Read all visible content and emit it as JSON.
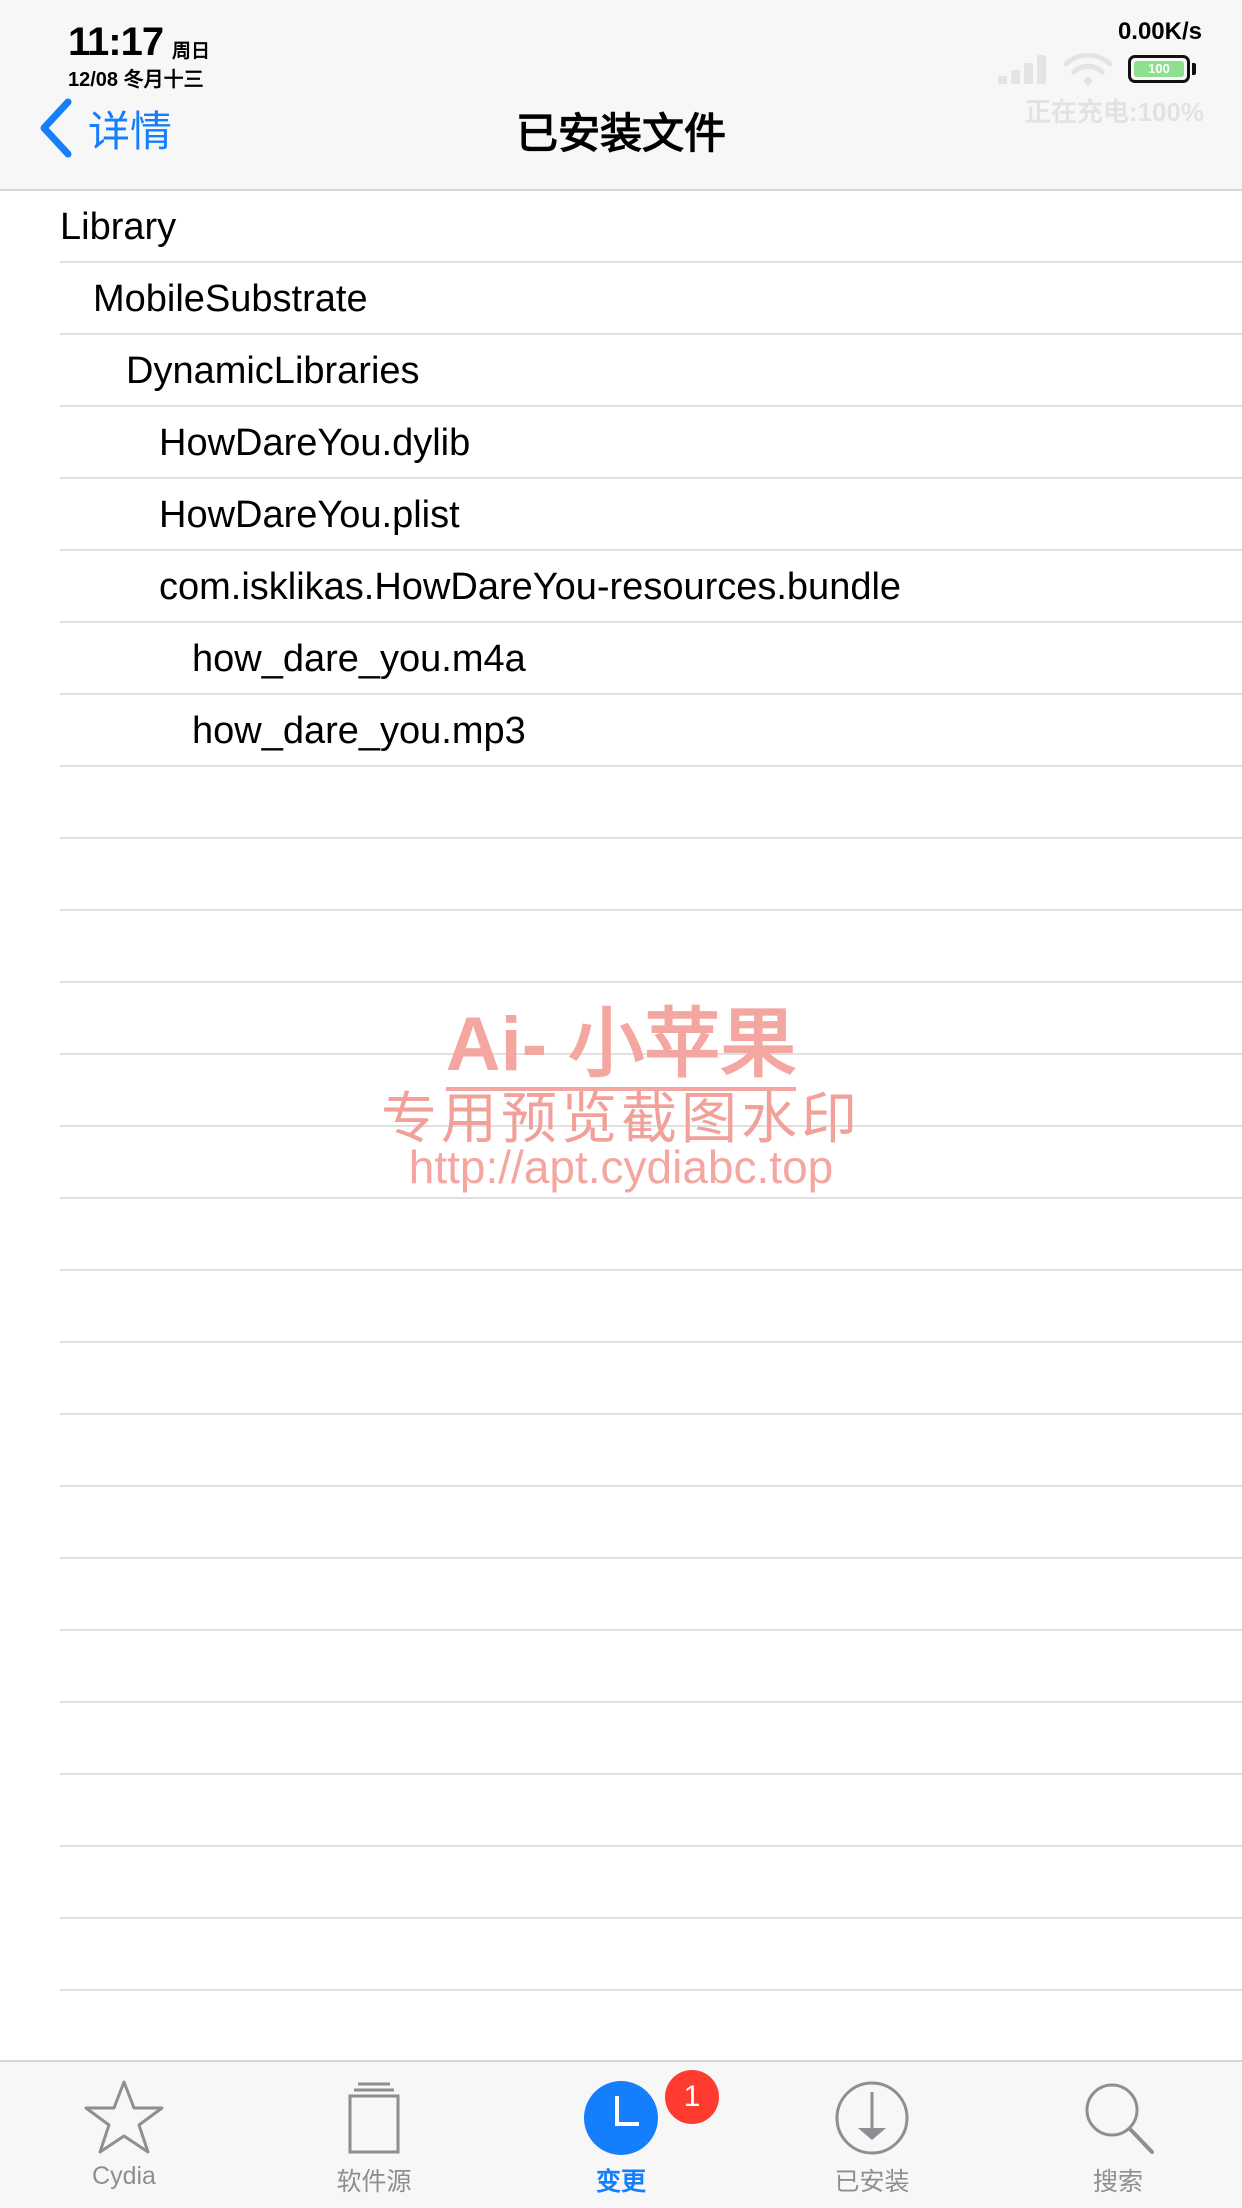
{
  "status_bar": {
    "time": "11:17",
    "weekday": "周日",
    "date": "12/08 冬月十三",
    "net_speed": "0.00K/s",
    "battery_text": "100",
    "charging": "正在充电:100%"
  },
  "nav": {
    "back_label": "详情",
    "title": "已安装文件"
  },
  "files": [
    {
      "name": "Library",
      "depth": 0
    },
    {
      "name": "MobileSubstrate",
      "depth": 1
    },
    {
      "name": "DynamicLibraries",
      "depth": 2
    },
    {
      "name": "HowDareYou.dylib",
      "depth": 3
    },
    {
      "name": "HowDareYou.plist",
      "depth": 3
    },
    {
      "name": "com.isklikas.HowDareYou-resources.bundle",
      "depth": 3
    },
    {
      "name": "how_dare_you.m4a",
      "depth": 4
    },
    {
      "name": "how_dare_you.mp3",
      "depth": 4
    }
  ],
  "watermark": {
    "line1": "Ai- 小苹果",
    "line2": "专用预览截图水印",
    "line3": "http://apt.cydiabc.top"
  },
  "tabbar": {
    "tabs": [
      {
        "label": "Cydia",
        "icon": "star-icon",
        "active": false
      },
      {
        "label": "软件源",
        "icon": "sources-icon",
        "active": false
      },
      {
        "label": "变更",
        "icon": "clock-icon",
        "active": true
      },
      {
        "label": "已安装",
        "icon": "download-icon",
        "active": false
      },
      {
        "label": "搜索",
        "icon": "search-icon",
        "active": false
      }
    ],
    "badge": "1"
  },
  "colors": {
    "accent": "#147efb",
    "badge": "#ff3b30",
    "watermark": "#f4a6a0"
  }
}
